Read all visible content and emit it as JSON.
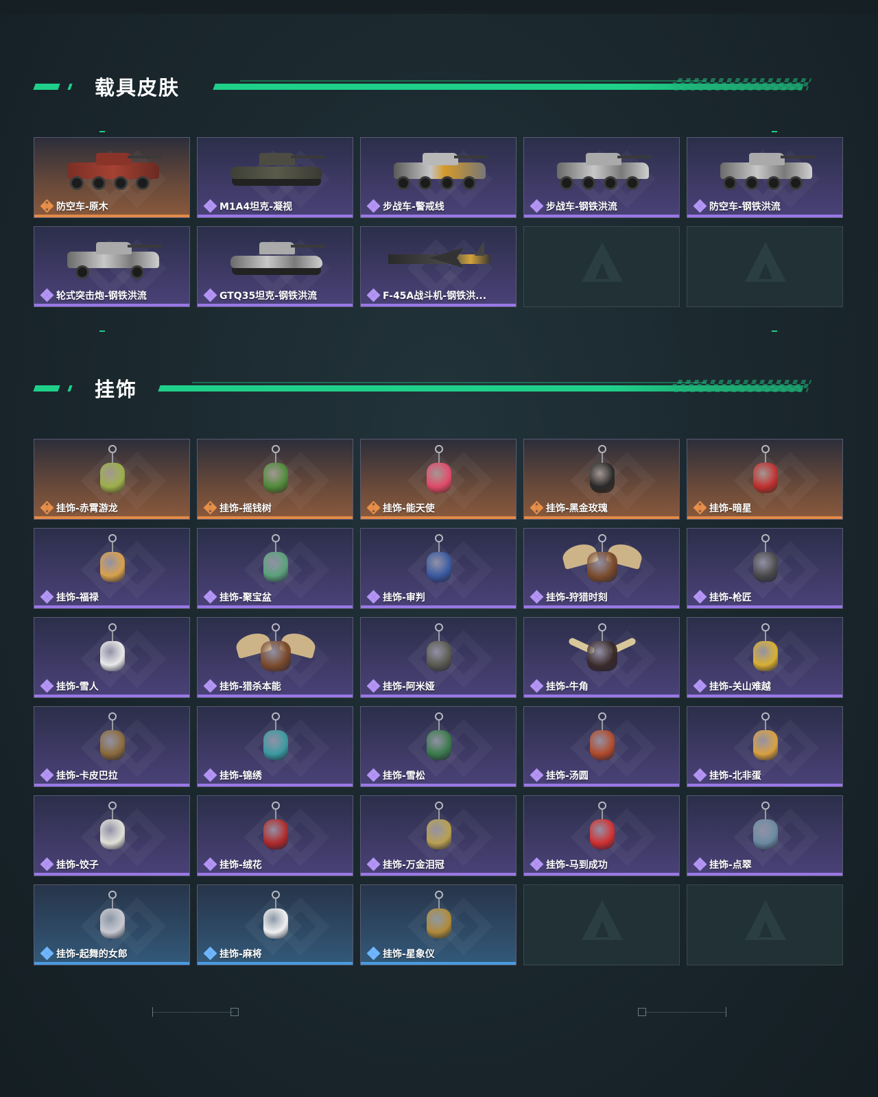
{
  "sections": {
    "vehicles": {
      "title": "载具皮肤"
    },
    "pendants": {
      "title": "挂饰"
    }
  },
  "colors": {
    "accent": "#1fd08a",
    "rarity_orange": "#e38a48",
    "rarity_purple": "#9a78e6",
    "rarity_blue": "#4a9ae0"
  },
  "vehicle_skins": [
    {
      "label": "防空车-原木",
      "rarity": "orange",
      "art": "red"
    },
    {
      "label": "M1A4坦克-凝视",
      "rarity": "purple",
      "art": "camo-tank"
    },
    {
      "label": "步战车-警戒线",
      "rarity": "purple",
      "art": "warn"
    },
    {
      "label": "步战车-钢铁洪流",
      "rarity": "purple",
      "art": "white"
    },
    {
      "label": "防空车-钢铁洪流",
      "rarity": "purple",
      "art": "white"
    },
    {
      "label": "轮式突击炮-钢铁洪流",
      "rarity": "purple",
      "art": "white-small"
    },
    {
      "label": "GTQ35坦克-钢铁洪流",
      "rarity": "purple",
      "art": "white-tank"
    },
    {
      "label": "F-45A战斗机-钢铁洪...",
      "rarity": "purple",
      "art": "jet"
    }
  ],
  "pendants": [
    {
      "label": "挂饰-赤霄游龙",
      "rarity": "orange",
      "color": "#9bb04a"
    },
    {
      "label": "挂饰-摇钱树",
      "rarity": "orange",
      "color": "#4f8a3a"
    },
    {
      "label": "挂饰-能天使",
      "rarity": "orange",
      "color": "#e04a6a"
    },
    {
      "label": "挂饰-黑金玫瑰",
      "rarity": "orange",
      "color": "#2a2a2a"
    },
    {
      "label": "挂饰-暗星",
      "rarity": "orange",
      "color": "#c03030"
    },
    {
      "label": "挂饰-福禄",
      "rarity": "purple",
      "color": "#d8a04a"
    },
    {
      "label": "挂饰-聚宝盆",
      "rarity": "purple",
      "color": "#5aa07a"
    },
    {
      "label": "挂饰-审判",
      "rarity": "purple",
      "color": "#3a5aa0"
    },
    {
      "label": "挂饰-狩猎时刻",
      "rarity": "purple",
      "color": "#7a4a2a",
      "shape": "antler"
    },
    {
      "label": "挂饰-枪匠",
      "rarity": "purple",
      "color": "#4a4a4a"
    },
    {
      "label": "挂饰-雪人",
      "rarity": "purple",
      "color": "#e8e8e8"
    },
    {
      "label": "挂饰-猎杀本能",
      "rarity": "purple",
      "color": "#7a4a2a",
      "shape": "antler"
    },
    {
      "label": "挂饰-阿米娅",
      "rarity": "purple",
      "color": "#5a5a50"
    },
    {
      "label": "挂饰-牛角",
      "rarity": "purple",
      "color": "#3a2a2a",
      "shape": "horn"
    },
    {
      "label": "挂饰-关山难越",
      "rarity": "purple",
      "color": "#d8b030"
    },
    {
      "label": "挂饰-卡皮巴拉",
      "rarity": "purple",
      "color": "#8a6a3a"
    },
    {
      "label": "挂饰-锦绣",
      "rarity": "purple",
      "color": "#3a9aa0"
    },
    {
      "label": "挂饰-雪松",
      "rarity": "purple",
      "color": "#3a7a4a"
    },
    {
      "label": "挂饰-汤圆",
      "rarity": "purple",
      "color": "#b04a2a"
    },
    {
      "label": "挂饰-北非蛋",
      "rarity": "purple",
      "color": "#d8a040"
    },
    {
      "label": "挂饰-饺子",
      "rarity": "purple",
      "color": "#e0e0d8"
    },
    {
      "label": "挂饰-绒花",
      "rarity": "purple",
      "color": "#b02a2a"
    },
    {
      "label": "挂饰-万金泪冠",
      "rarity": "purple",
      "color": "#b8a050"
    },
    {
      "label": "挂饰-马到成功",
      "rarity": "purple",
      "color": "#d03030"
    },
    {
      "label": "挂饰-点翠",
      "rarity": "purple",
      "color": "#6a8aa0"
    },
    {
      "label": "挂饰-起舞的女郎",
      "rarity": "blue",
      "color": "#c8c8d0"
    },
    {
      "label": "挂饰-麻将",
      "rarity": "blue",
      "color": "#f0f0f0"
    },
    {
      "label": "挂饰-星象仪",
      "rarity": "blue",
      "color": "#b08a3a"
    }
  ]
}
